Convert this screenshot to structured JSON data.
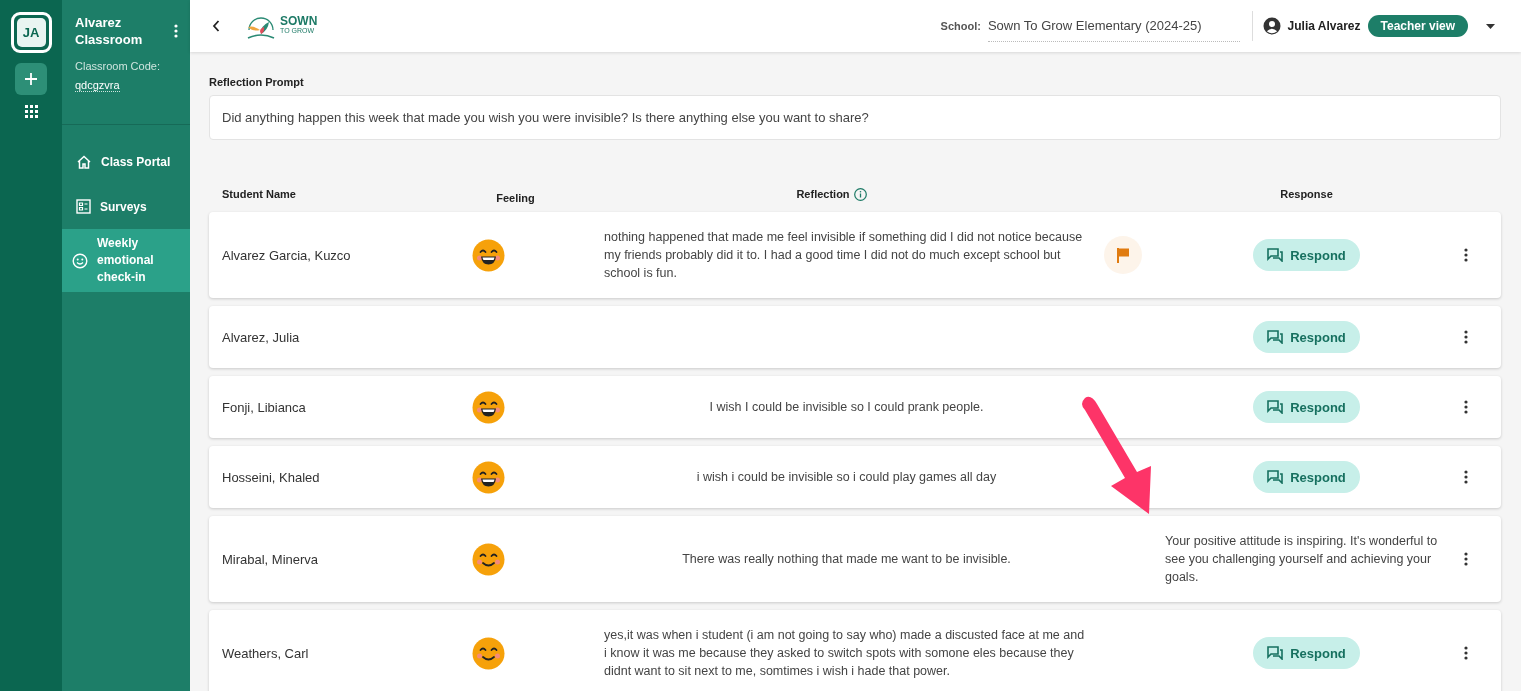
{
  "rail": {
    "avatar": "JA"
  },
  "sidebar": {
    "classroom": "Alvarez Classroom",
    "code_label": "Classroom Code:",
    "code": "qdcgzvra",
    "items": [
      {
        "label": "Class Portal",
        "selected": false
      },
      {
        "label": "Surveys",
        "selected": false
      },
      {
        "label": "Weekly emotional check-in",
        "selected": true
      }
    ]
  },
  "header": {
    "logo_top": "SOWN",
    "logo_bottom": "TO GROW",
    "school_label": "School:",
    "school": "Sown To Grow Elementary (2024-25)",
    "user": "Julia Alvarez",
    "role": "Teacher view"
  },
  "prompt": {
    "label": "Reflection Prompt",
    "text": "Did anything happen this week that made you wish you were invisible? Is there anything else you want to share?"
  },
  "columns": [
    "Student Name",
    "Feeling",
    "Reflection",
    "Response"
  ],
  "rows": [
    {
      "name": "Alvarez Garcia, Kuzco",
      "feeling": {
        "kind": "grin"
      },
      "reflection": "nothing happened that made me feel invisible if something did I did not notice because my friends probably did it to. I had a good time I did not do much except school but school is fun.",
      "flagged": true,
      "response": {
        "kind": "button",
        "text": "Respond"
      }
    },
    {
      "name": "Alvarez, Julia",
      "flagged": false,
      "response": {
        "kind": "button",
        "text": "Respond"
      }
    },
    {
      "name": "Fonji, Libianca",
      "feeling": {
        "kind": "grin"
      },
      "reflection": "I wish I could be invisible so I could prank people.",
      "flagged": false,
      "response": {
        "kind": "button",
        "text": "Respond"
      }
    },
    {
      "name": "Hosseini, Khaled",
      "feeling": {
        "kind": "grin"
      },
      "reflection": "i wish i could be invisible so i could play games all day",
      "flagged": false,
      "response": {
        "kind": "button",
        "text": "Respond"
      }
    },
    {
      "name": "Mirabal, Minerva",
      "feeling": {
        "kind": "smile"
      },
      "reflection": "There was really nothing that made me want to be invisible.",
      "flagged": false,
      "response": {
        "kind": "text",
        "text": "Your positive attitude is inspiring. It's wonderful to see you challenging yourself and achieving your goals."
      }
    },
    {
      "name": "Weathers, Carl",
      "feeling": {
        "kind": "smile"
      },
      "reflection": "yes,it was when i student (i am not going to say who) made a discusted face at me and i know it was me because they asked to switch spots with somone eles because they didnt want to sit next to me, somtimes i wish i hade that power.",
      "flagged": false,
      "response": {
        "kind": "button",
        "text": "Respond"
      }
    }
  ]
}
